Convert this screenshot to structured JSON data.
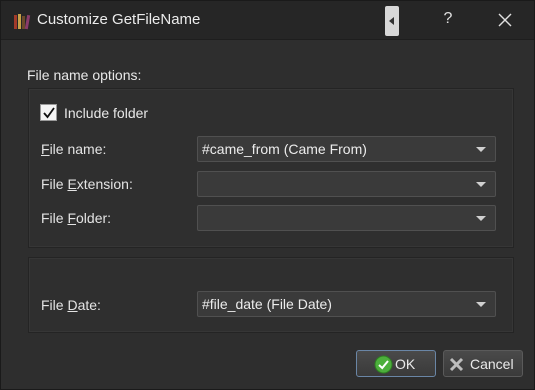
{
  "window": {
    "title": "Customize GetFileName",
    "help_glyph": "?"
  },
  "options": {
    "section_label": "File name options:",
    "include_folder": {
      "label": "Include folder",
      "checked": true
    },
    "file_name": {
      "label_pre": "",
      "label_mnemonic": "F",
      "label_post": "ile name:",
      "value": "#came_from (Came From)"
    },
    "file_extension": {
      "label_pre": "File ",
      "label_mnemonic": "E",
      "label_post": "xtension:",
      "value": ""
    },
    "file_folder": {
      "label_pre": "File ",
      "label_mnemonic": "F",
      "label_post": "older:",
      "value": ""
    }
  },
  "date": {
    "file_date": {
      "label_pre": "File ",
      "label_mnemonic": "D",
      "label_post": "ate:",
      "value": "#file_date (File Date)"
    }
  },
  "buttons": {
    "ok": "OK",
    "cancel": "Cancel"
  },
  "icons": {
    "app": "books-icon",
    "ok": "green-check-circle-icon",
    "cancel": "gray-x-icon"
  }
}
